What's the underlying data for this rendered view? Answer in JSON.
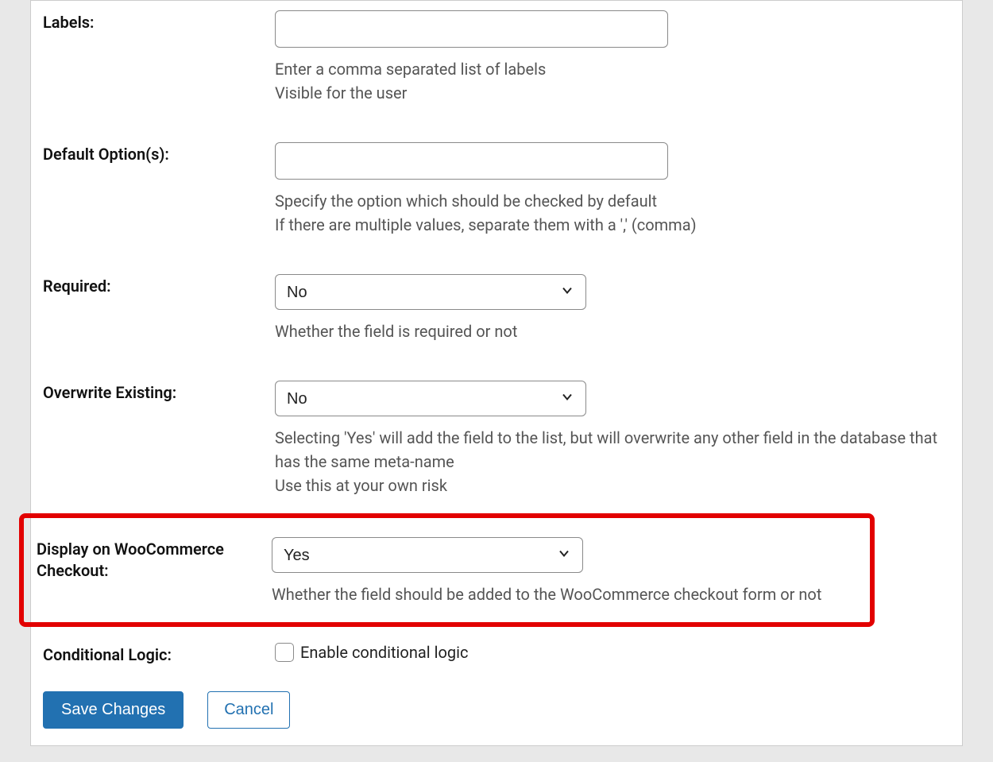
{
  "fields": {
    "labels": {
      "label": "Labels:",
      "value": "",
      "help1": "Enter a comma separated list of labels",
      "help2": "Visible for the user"
    },
    "default_options": {
      "label": "Default Option(s):",
      "value": "",
      "help1": "Specify the option which should be checked by default",
      "help2": "If there are multiple values, separate them with a ',' (comma)"
    },
    "required": {
      "label": "Required:",
      "value": "No",
      "help": "Whether the field is required or not"
    },
    "overwrite": {
      "label": "Overwrite Existing:",
      "value": "No",
      "help1": "Selecting 'Yes' will add the field to the list, but will overwrite any other field in the database that has the same meta-name",
      "help2": "Use this at your own risk"
    },
    "woocommerce": {
      "label": "Display on WooCommerce Checkout:",
      "value": "Yes",
      "help": "Whether the field should be added to the WooCommerce checkout form or not"
    },
    "conditional": {
      "label": "Conditional Logic:",
      "checkbox_label": "Enable conditional logic"
    }
  },
  "buttons": {
    "save": "Save Changes",
    "cancel": "Cancel"
  }
}
